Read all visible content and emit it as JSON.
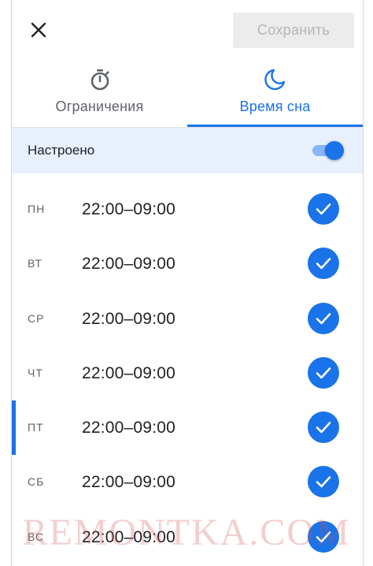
{
  "header": {
    "close_icon": "close-icon",
    "save_label": "Сохранить"
  },
  "tabs": [
    {
      "label": "Ограничения",
      "icon": "timer-icon",
      "active": false
    },
    {
      "label": "Время сна",
      "icon": "moon-icon",
      "active": true
    }
  ],
  "setting": {
    "label": "Настроено",
    "enabled": true
  },
  "days": [
    {
      "abbr": "ПН",
      "time": "22:00–09:00",
      "checked": true
    },
    {
      "abbr": "ВТ",
      "time": "22:00–09:00",
      "checked": true
    },
    {
      "abbr": "СР",
      "time": "22:00–09:00",
      "checked": true
    },
    {
      "abbr": "ЧТ",
      "time": "22:00–09:00",
      "checked": true
    },
    {
      "abbr": "ПТ",
      "time": "22:00–09:00",
      "checked": true,
      "selected": true
    },
    {
      "abbr": "СБ",
      "time": "22:00–09:00",
      "checked": true
    },
    {
      "abbr": "ВС",
      "time": "22:00–09:00",
      "checked": true
    }
  ],
  "watermark": "REMONTKA.COM",
  "colors": {
    "accent": "#1a73e8",
    "accent_light": "#e8f0fe",
    "toggle_track": "#8ab4f8",
    "watermark": "#d75050"
  }
}
